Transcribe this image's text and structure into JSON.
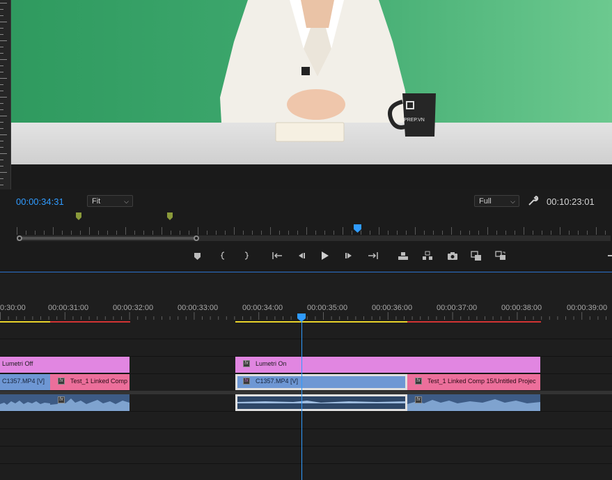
{
  "monitor": {
    "current_timecode": "00:00:34:31",
    "zoom_select": "Fit",
    "resolution_select": "Full",
    "duration_timecode": "00:10:23:01",
    "mug_text": "PREP.VN",
    "controls": [
      "add-marker",
      "mark-in",
      "mark-out",
      "go-to-in",
      "step-back",
      "play",
      "step-forward",
      "go-to-out",
      "lift",
      "extract",
      "export-frame",
      "compare-view",
      "button-editor"
    ]
  },
  "timeline": {
    "ruler_labels": [
      "0:30:00",
      "00:00:31:00",
      "00:00:32:00",
      "00:00:33:00",
      "00:00:34:00",
      "00:00:35:00",
      "00:00:36:00",
      "00:00:37:00",
      "00:00:38:00",
      "00:00:39:00"
    ],
    "adjustment_clips": [
      {
        "label": "Lumetri Off"
      },
      {
        "label": "Lumetri On"
      }
    ],
    "video_clips": [
      {
        "label": "C1357.MP4 [V]"
      },
      {
        "label": "Test_1 Linked Comp"
      },
      {
        "label": "C1357.MP4 [V]"
      },
      {
        "label": "Test_1 Linked Comp 15/Untitled Projec"
      }
    ],
    "colors": {
      "adjustment": "#e186e1",
      "linked_comp": "#ec6f9b",
      "video": "#6e97d4",
      "audio": "#4a6a95",
      "playhead": "#2f9bff",
      "work_yellow": "#e8d32a",
      "work_red": "#d33333"
    }
  }
}
